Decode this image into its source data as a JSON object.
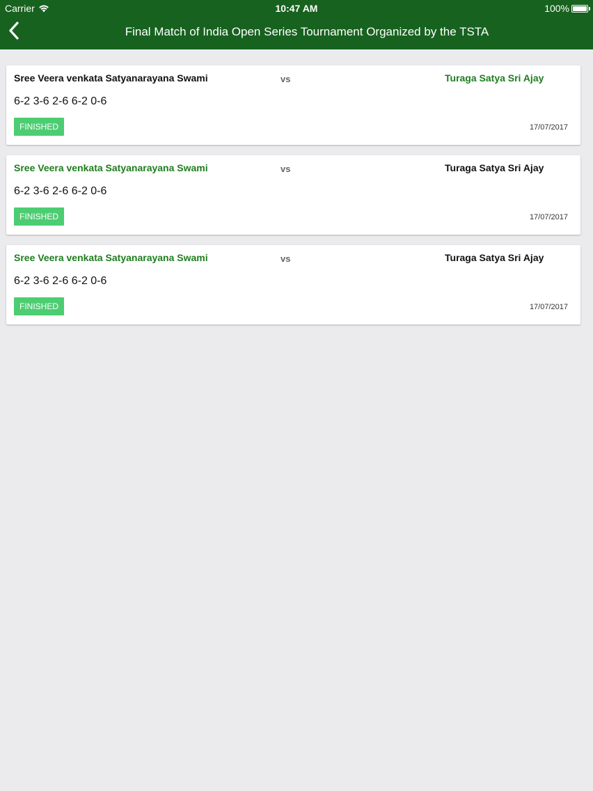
{
  "status_bar": {
    "carrier": "Carrier",
    "time": "10:47 AM",
    "battery": "100%"
  },
  "nav": {
    "title": "Final Match of India Open Series Tournament Organized by the TSTA"
  },
  "colors": {
    "nav_background": "#17621f",
    "winner_text": "#1e7d1e",
    "badge": "#4ccd72",
    "page_background": "#ebebee"
  },
  "matches": [
    {
      "player_a": "Sree Veera venkata Satyanarayana Swami",
      "vs": "vs",
      "player_b": "Turaga Satya Sri Ajay",
      "score": "6-2 3-6 2-6 6-2 0-6",
      "status": "FINISHED",
      "date": "17/07/2017",
      "winner": "b"
    },
    {
      "player_a": "Sree Veera venkata Satyanarayana Swami",
      "vs": "vs",
      "player_b": "Turaga Satya Sri Ajay",
      "score": "6-2 3-6 2-6 6-2 0-6",
      "status": "FINISHED",
      "date": "17/07/2017",
      "winner": "a"
    },
    {
      "player_a": "Sree Veera venkata Satyanarayana Swami",
      "vs": "vs",
      "player_b": "Turaga Satya Sri Ajay",
      "score": "6-2 3-6 2-6 6-2 0-6",
      "status": "FINISHED",
      "date": "17/07/2017",
      "winner": "a"
    }
  ]
}
